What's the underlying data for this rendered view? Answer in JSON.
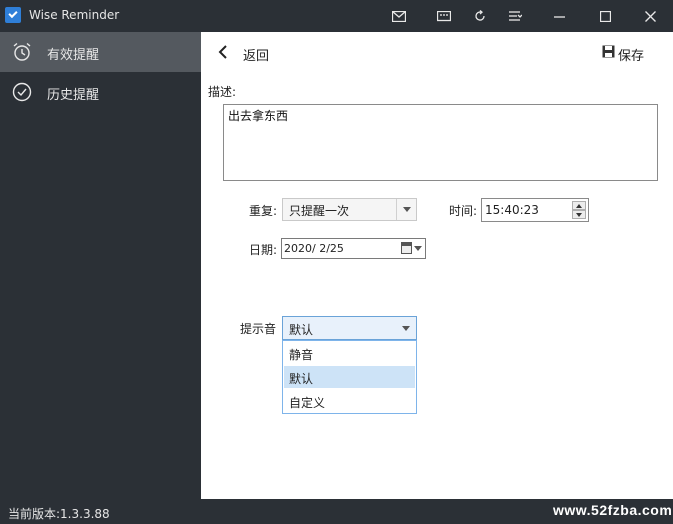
{
  "app": {
    "title": "Wise Reminder"
  },
  "titlebar": {
    "buttons": [
      "mail-icon",
      "feedback-icon",
      "refresh-icon",
      "menu-icon",
      "minimize-icon",
      "maximize-icon",
      "close-icon"
    ]
  },
  "sidebar": {
    "items": [
      {
        "label": "有效提醒",
        "icon": "alarm-clock-icon",
        "active": true
      },
      {
        "label": "历史提醒",
        "icon": "check-circle-icon",
        "active": false
      }
    ]
  },
  "header": {
    "back_label": "返回",
    "save_label": "保存"
  },
  "form": {
    "description_label": "描述:",
    "description_value": "出去拿东西",
    "repeat_label": "重复:",
    "repeat_value": "只提醒一次",
    "time_label": "时间:",
    "time_value": "15:40:23",
    "date_label": "日期:",
    "date_value": "2020/  2/25",
    "sound_label": "提示音",
    "sound_value": "默认",
    "sound_options": [
      "静音",
      "默认",
      "自定义"
    ],
    "sound_selected_index": 1
  },
  "status": {
    "version": "当前版本:1.3.3.88",
    "watermark": "www.52fzba.com"
  },
  "colors": {
    "chrome": "#2b3036",
    "sidebar_active": "#54595f",
    "accent": "#2f7fd8",
    "dropdown_selected": "#cde3f7"
  }
}
